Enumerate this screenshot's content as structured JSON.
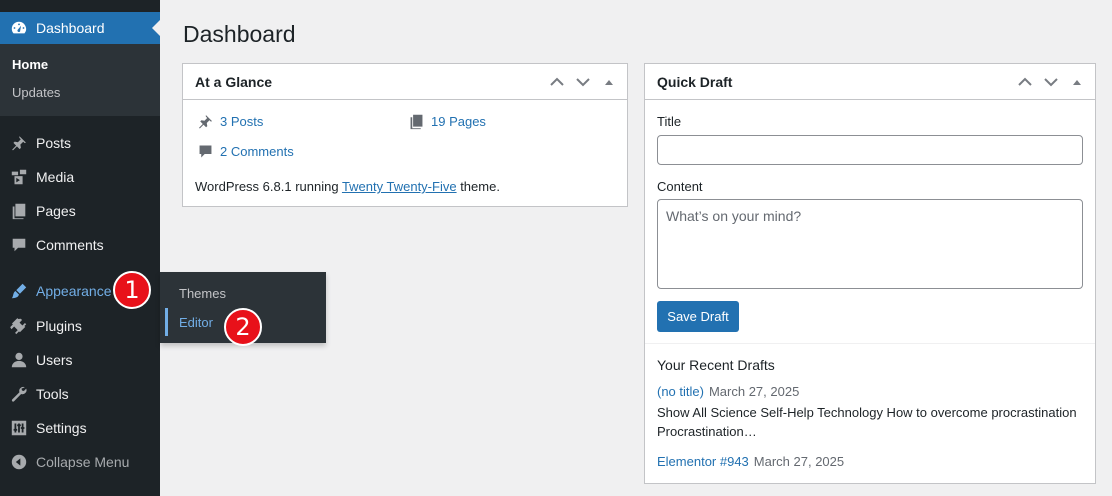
{
  "sidebar": {
    "dashboard_label": "Dashboard",
    "submenu": [
      "Home",
      "Updates"
    ],
    "items": {
      "posts": "Posts",
      "media": "Media",
      "pages": "Pages",
      "comments": "Comments",
      "appearance": "Appearance",
      "plugins": "Plugins",
      "users": "Users",
      "tools": "Tools",
      "settings": "Settings",
      "collapse": "Collapse Menu"
    }
  },
  "flyout": {
    "themes": "Themes",
    "editor": "Editor"
  },
  "badges": {
    "first": "1",
    "second": "2"
  },
  "page_title": "Dashboard",
  "at_a_glance": {
    "title": "At a Glance",
    "posts": "3 Posts",
    "pages": "19 Pages",
    "comments": "2 Comments",
    "version_prefix": "WordPress 6.8.1 running ",
    "theme_link": "Twenty Twenty-Five",
    "version_suffix": " theme."
  },
  "quick_draft": {
    "title": "Quick Draft",
    "title_label": "Title",
    "content_label": "Content",
    "content_placeholder": "What’s on your mind?",
    "save_label": "Save Draft",
    "recent_title": "Your Recent Drafts",
    "drafts": [
      {
        "title": "(no title)",
        "date": "March 27, 2025",
        "excerpt": "Show All Science Self-Help Technology How to overcome procrastination Procrastination…"
      },
      {
        "title": "Elementor #943",
        "date": "March 27, 2025"
      }
    ]
  },
  "colors": {
    "accent": "#2271b1",
    "sidebar": "#1d2327",
    "badge": "#e8111a"
  }
}
